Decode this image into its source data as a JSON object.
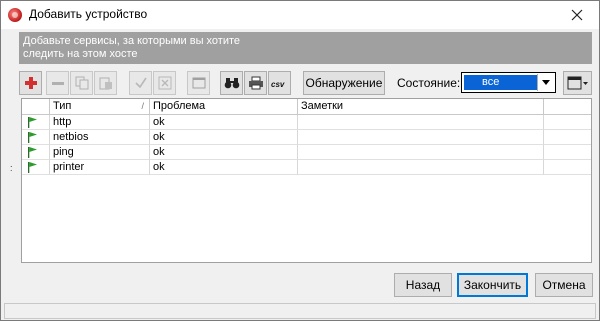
{
  "window": {
    "title": "Добавить устройство"
  },
  "banner": {
    "line1": "Добавьте сервисы, за которыми вы хотите",
    "line2": "следить на этом хосте"
  },
  "toolbar": {
    "discover_label": "Обнаружение",
    "state_label": "Состояние:",
    "state_value": "все",
    "icons": [
      "add-icon",
      "remove-icon",
      "copy-icon",
      "paste-icon",
      "check-icon",
      "delete-icon",
      "window-icon",
      "binoculars-icon",
      "printer-icon",
      "csv-icon",
      "panel-icon"
    ]
  },
  "grid": {
    "columns": {
      "type": "Тип",
      "problem": "Проблема",
      "notes": "Заметки"
    },
    "rows": [
      {
        "type": "http",
        "problem": "ok",
        "notes": ""
      },
      {
        "type": "netbios",
        "problem": "ok",
        "notes": ""
      },
      {
        "type": "ping",
        "problem": "ok",
        "notes": ""
      },
      {
        "type": "printer",
        "problem": "ok",
        "notes": ""
      }
    ]
  },
  "buttons": {
    "back": "Назад",
    "finish": "Закончить",
    "cancel": "Отмена"
  },
  "colors": {
    "accent": "#0078d7",
    "selection": "#0a64d6",
    "banner": "#a0a0a0",
    "flag": "#2e9b2e",
    "add": "#d32f2f"
  }
}
